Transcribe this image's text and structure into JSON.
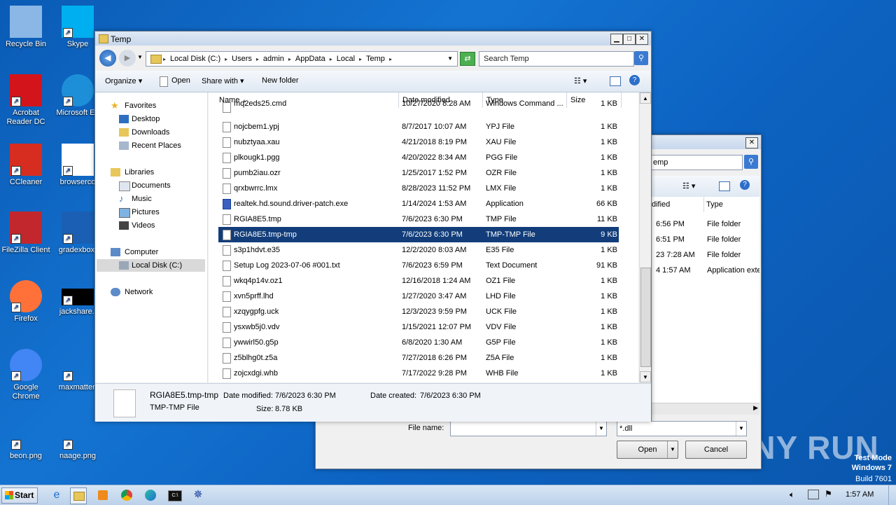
{
  "desktop": {
    "icons": [
      {
        "label": "Recycle Bin"
      },
      {
        "label": "Skype"
      },
      {
        "label": "Acrobat Reader DC"
      },
      {
        "label": "Microsoft Ed"
      },
      {
        "label": "CCleaner"
      },
      {
        "label": "browserco"
      },
      {
        "label": "FileZilla Client"
      },
      {
        "label": "gradexbox."
      },
      {
        "label": "Firefox"
      },
      {
        "label": "jackshare.j"
      },
      {
        "label": "Google Chrome"
      },
      {
        "label": "maxmatter."
      },
      {
        "label": "beon.png"
      },
      {
        "label": "naage.png"
      }
    ],
    "watermark": "ANY RUN",
    "test_mode": "Test Mode",
    "os_name": "Windows 7",
    "build": "Build 7601"
  },
  "explorer": {
    "title": "Temp",
    "breadcrumb": [
      "Local Disk (C:)",
      "Users",
      "admin",
      "AppData",
      "Local",
      "Temp"
    ],
    "search_placeholder": "Search Temp",
    "toolbar": {
      "organize": "Organize",
      "open": "Open",
      "share_with": "Share with",
      "new_folder": "New folder"
    },
    "nav": {
      "favorites": "Favorites",
      "desktop": "Desktop",
      "downloads": "Downloads",
      "recent": "Recent Places",
      "libraries": "Libraries",
      "documents": "Documents",
      "music": "Music",
      "pictures": "Pictures",
      "videos": "Videos",
      "computer": "Computer",
      "local_disk": "Local Disk (C:)",
      "network": "Network"
    },
    "columns": {
      "name": "Name",
      "date": "Date modified",
      "type": "Type",
      "size": "Size"
    },
    "files": [
      {
        "name": "mq2eds25.cmd",
        "date": "10/27/2020 8:28 AM",
        "type": "Windows Command ...",
        "size": "1 KB"
      },
      {
        "name": "nojcbem1.ypj",
        "date": "8/7/2017 10:07 AM",
        "type": "YPJ File",
        "size": "1 KB"
      },
      {
        "name": "nubztyaa.xau",
        "date": "4/21/2018 8:19 PM",
        "type": "XAU File",
        "size": "1 KB"
      },
      {
        "name": "plkougk1.pgg",
        "date": "4/20/2022 8:34 AM",
        "type": "PGG File",
        "size": "1 KB"
      },
      {
        "name": "pumb2iau.ozr",
        "date": "1/25/2017 1:52 PM",
        "type": "OZR File",
        "size": "1 KB"
      },
      {
        "name": "qrxbwrrc.lmx",
        "date": "8/28/2023 11:52 PM",
        "type": "LMX File",
        "size": "1 KB"
      },
      {
        "name": "realtek.hd.sound.driver-patch.exe",
        "date": "1/14/2024 1:53 AM",
        "type": "Application",
        "size": "66 KB"
      },
      {
        "name": "RGIA8E5.tmp",
        "date": "7/6/2023 6:30 PM",
        "type": "TMP File",
        "size": "11 KB"
      },
      {
        "name": "RGIA8E5.tmp-tmp",
        "date": "7/6/2023 6:30 PM",
        "type": "TMP-TMP File",
        "size": "9 KB"
      },
      {
        "name": "s3p1hdvt.e35",
        "date": "12/2/2020 8:03 AM",
        "type": "E35 File",
        "size": "1 KB"
      },
      {
        "name": "Setup Log 2023-07-06 #001.txt",
        "date": "7/6/2023 6:59 PM",
        "type": "Text Document",
        "size": "91 KB"
      },
      {
        "name": "wkq4p14v.oz1",
        "date": "12/16/2018 1:24 AM",
        "type": "OZ1 File",
        "size": "1 KB"
      },
      {
        "name": "xvn5prff.lhd",
        "date": "1/27/2020 3:47 AM",
        "type": "LHD File",
        "size": "1 KB"
      },
      {
        "name": "xzqygpfg.uck",
        "date": "12/3/2023 9:59 PM",
        "type": "UCK File",
        "size": "1 KB"
      },
      {
        "name": "ysxwb5j0.vdv",
        "date": "1/15/2021 12:07 PM",
        "type": "VDV File",
        "size": "1 KB"
      },
      {
        "name": "ywwirl50.g5p",
        "date": "6/8/2020 1:30 AM",
        "type": "G5P File",
        "size": "1 KB"
      },
      {
        "name": "z5blhg0t.z5a",
        "date": "7/27/2018 6:26 PM",
        "type": "Z5A File",
        "size": "1 KB"
      },
      {
        "name": "zojcxdgi.whb",
        "date": "7/17/2022 9:28 PM",
        "type": "WHB File",
        "size": "1 KB"
      }
    ],
    "selected_index": 8,
    "details": {
      "name": "RGIA8E5.tmp-tmp",
      "type": "TMP-TMP File",
      "date_modified_label": "Date modified:",
      "date_modified": "7/6/2023 6:30 PM",
      "size_label": "Size:",
      "size": "8.78 KB",
      "date_created_label": "Date created:",
      "date_created": "7/6/2023 6:30 PM"
    }
  },
  "dialog": {
    "search_text": "emp",
    "col_modified": "dified",
    "col_type": "Type",
    "rows": [
      {
        "date": "6:56 PM",
        "type": "File folder"
      },
      {
        "date": "6:51 PM",
        "type": "File folder"
      },
      {
        "date": "23 7:28 AM",
        "type": "File folder"
      },
      {
        "date": "4 1:57 AM",
        "type": "Application exte"
      }
    ],
    "file_name_label": "File name:",
    "file_name_value": "",
    "filter": "*.dll",
    "open": "Open",
    "cancel": "Cancel"
  },
  "taskbar": {
    "start": "Start",
    "clock": "1:57 AM"
  }
}
